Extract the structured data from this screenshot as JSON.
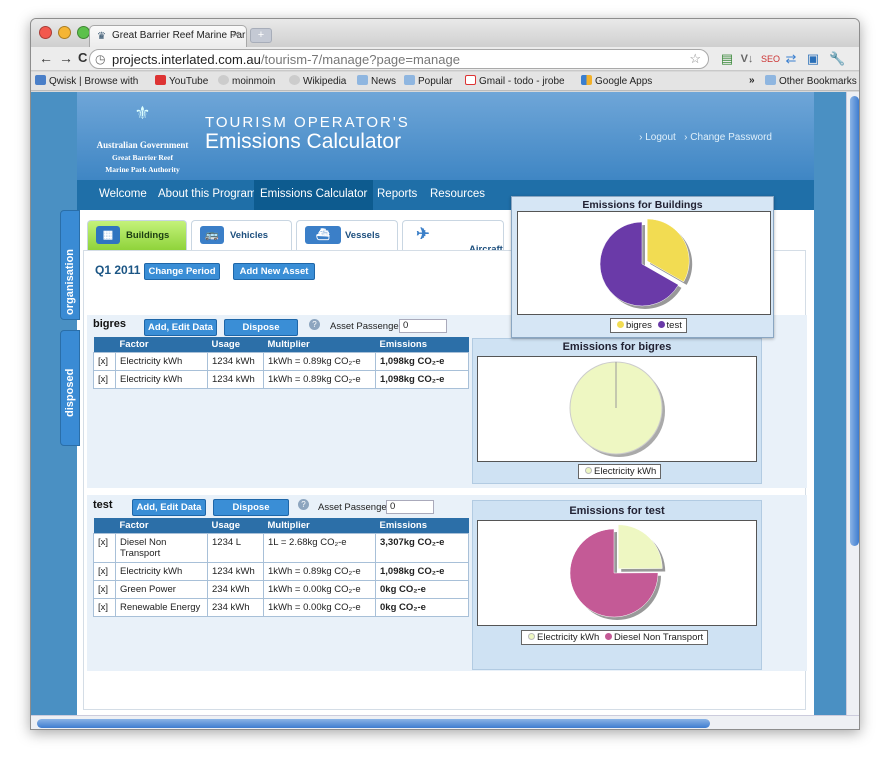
{
  "browser": {
    "tab_title": "Great Barrier Reef Marine Par",
    "url_host": "projects.interlated.com.au",
    "url_path": "/tourism-7/manage?page=manage",
    "bookmarks": [
      "Qwisk | Browse with",
      "YouTube",
      "moinmoin",
      "Wikipedia",
      "News",
      "Popular",
      "Gmail - todo - jrobe",
      "Google Apps"
    ],
    "other_bookmarks": "Other Bookmarks",
    "chevron": "»"
  },
  "header": {
    "gov_line1": "Australian Government",
    "gov_line2": "Great Barrier Reef",
    "gov_line3": "Marine Park Authority",
    "title_line1": "TOURISM OPERATOR'S",
    "title_line2": "Emissions Calculator",
    "logout": "› Logout",
    "change_password": "› Change Password"
  },
  "nav": [
    "Welcome",
    "About this Program",
    "Emissions Calculator",
    "Reports",
    "Resources"
  ],
  "side_tabs": [
    "organisation",
    "disposed"
  ],
  "category_tabs": [
    {
      "label": "Buildings",
      "icon": "building-icon"
    },
    {
      "label": "Vehicles",
      "icon": "bus-icon"
    },
    {
      "label": "Vessels",
      "icon": "boat-icon"
    },
    {
      "label": "Aircraft\nand Travel",
      "icon": "plane-icon"
    }
  ],
  "period": {
    "label": "Q1 2011",
    "change_button": "Change Period",
    "add_asset_button": "Add New Asset"
  },
  "table_headers": [
    "Factor",
    "Usage",
    "Multiplier",
    "Emissions"
  ],
  "assets": [
    {
      "name": "bigres",
      "edit_button": "Add, Edit Data",
      "dispose_button": "Dispose",
      "passengers_label": "Asset Passengers",
      "passengers_value": "0",
      "rows": [
        {
          "remove": "[x]",
          "factor": "Electricity kWh",
          "usage": "1234 kWh",
          "multiplier": "1kWh = 0.89kg CO₂-e",
          "emissions": "1,098kg CO₂-e"
        },
        {
          "remove": "[x]",
          "factor": "Electricity kWh",
          "usage": "1234 kWh",
          "multiplier": "1kWh = 0.89kg CO₂-e",
          "emissions": "1,098kg CO₂-e"
        }
      ]
    },
    {
      "name": "test",
      "edit_button": "Add, Edit Data",
      "dispose_button": "Dispose",
      "passengers_label": "Asset Passengers",
      "passengers_value": "0",
      "rows": [
        {
          "remove": "[x]",
          "factor": "Diesel Non Transport",
          "usage": "1234 L",
          "multiplier": "1L = 2.68kg CO₂-e",
          "emissions": "3,307kg CO₂-e"
        },
        {
          "remove": "[x]",
          "factor": "Electricity kWh",
          "usage": "1234 kWh",
          "multiplier": "1kWh = 0.89kg CO₂-e",
          "emissions": "1,098kg CO₂-e"
        },
        {
          "remove": "[x]",
          "factor": "Green Power",
          "usage": "234 kWh",
          "multiplier": "1kWh = 0.00kg CO₂-e",
          "emissions": "0kg CO₂-e"
        },
        {
          "remove": "[x]",
          "factor": "Renewable Energy",
          "usage": "234 kWh",
          "multiplier": "1kWh = 0.00kg CO₂-e",
          "emissions": "0kg CO₂-e"
        }
      ]
    }
  ],
  "chart_data": [
    {
      "type": "pie",
      "title": "Emissions for Buildings",
      "series": [
        {
          "name": "bigres",
          "value": 2196,
          "color": "#f2dc52"
        },
        {
          "name": "test",
          "value": 4405,
          "color": "#6a3aa8"
        }
      ],
      "exploded": "bigres"
    },
    {
      "type": "pie",
      "title": "Emissions for bigres",
      "series": [
        {
          "name": "Electricity kWh",
          "value": 2196,
          "color": "#eef7c2"
        }
      ]
    },
    {
      "type": "pie",
      "title": "Emissions for test",
      "series": [
        {
          "name": "Electricity kWh",
          "value": 1098,
          "color": "#eef7c2"
        },
        {
          "name": "Diesel Non Transport",
          "value": 3307,
          "color": "#c45a96"
        }
      ],
      "exploded": "Electricity kWh"
    }
  ],
  "colors": {
    "nav_bg": "#1f6fa8",
    "button": "#3a8ed6",
    "active_tab": "#8fd33b",
    "header": "#4a90c3"
  }
}
